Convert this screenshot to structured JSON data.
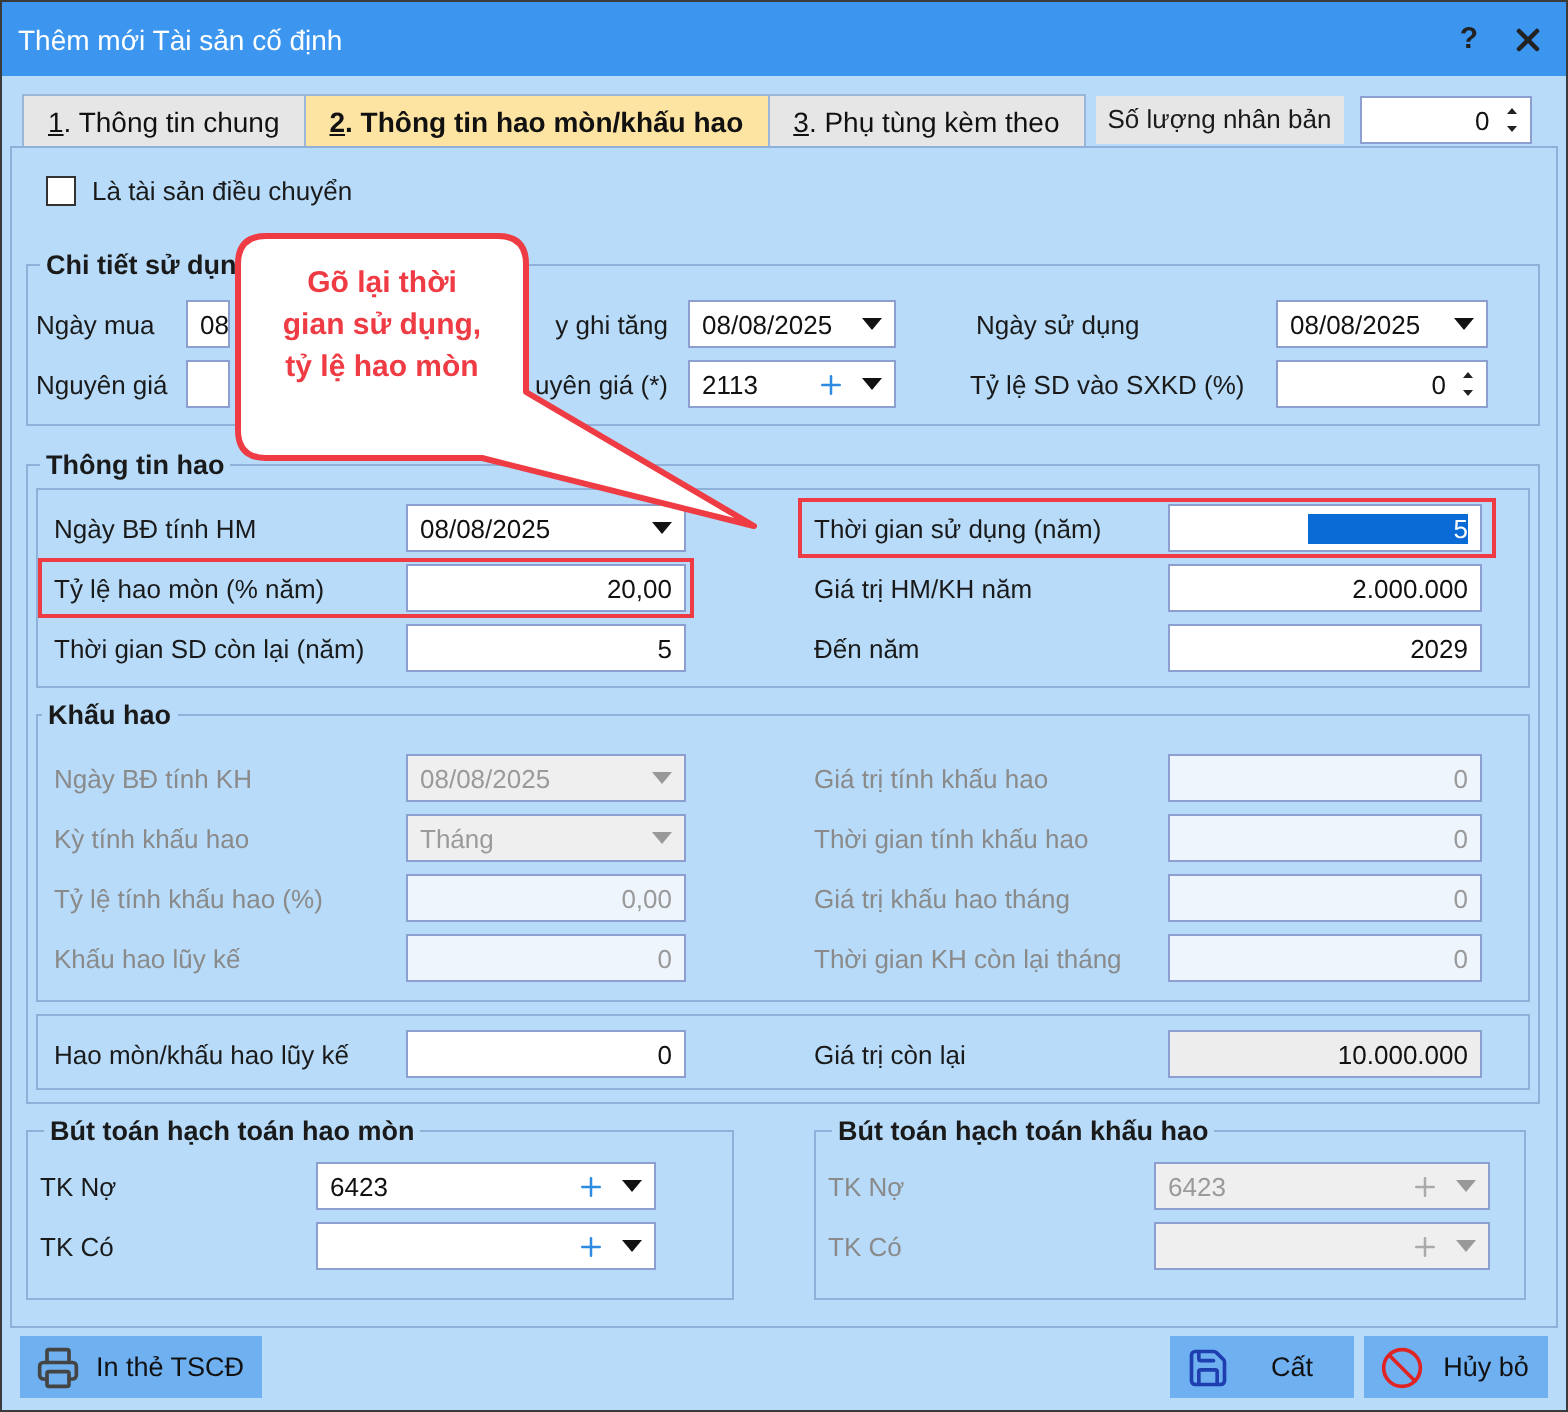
{
  "window": {
    "title": "Thêm mới Tài sản cố định",
    "help": "?"
  },
  "tabs": [
    {
      "label": "1. Thông tin chung",
      "selected": false
    },
    {
      "label": "2. Thông tin hao mòn/khấu hao",
      "selected": true
    },
    {
      "label": "3. Phụ tùng kèm theo",
      "selected": false
    }
  ],
  "copies": {
    "label": "Số lượng nhân bản",
    "value": "0"
  },
  "transfer": {
    "label": "Là tài sản điều chuyển",
    "checked": false
  },
  "usage": {
    "title": "Chi tiết sử dụn",
    "rows": [
      [
        {
          "label": "Ngày mua",
          "kind": "text",
          "value": "08"
        },
        {
          "label": "y ghi tăng",
          "kind": "date",
          "value": "08/08/2025"
        },
        {
          "label": "Ngày sử dụng",
          "kind": "date",
          "value": "08/08/2025"
        }
      ],
      [
        {
          "label": "Nguyên giá",
          "kind": "text"
        },
        {
          "label": "uyên giá (*)",
          "kind": "lookup",
          "value": "2113"
        },
        {
          "label": "Tỷ lệ SD vào SXKD (%)",
          "kind": "spin",
          "value": "0"
        }
      ]
    ]
  },
  "depreciation": {
    "title": "Thông tin hao",
    "wear": [
      [
        {
          "label": "Ngày BĐ tính HM",
          "kind": "date",
          "value": "08/08/2025",
          "highlighted": false,
          "value_selected": false
        },
        {
          "label": "Thời gian sử dụng (năm)",
          "kind": "number",
          "value": "5",
          "highlighted": true,
          "value_selected": true
        }
      ],
      [
        {
          "label": "Tỷ lệ hao mòn (% năm)",
          "kind": "number",
          "value": "20,00",
          "highlighted": true,
          "value_selected": false
        },
        {
          "label": "Giá trị HM/KH năm",
          "kind": "number",
          "value": "2.000.000",
          "highlighted": false,
          "value_selected": false
        }
      ],
      [
        {
          "label": "Thời gian SD còn lại (năm)",
          "kind": "number",
          "value": "5",
          "highlighted": false,
          "value_selected": false
        },
        {
          "label": "Đến năm",
          "kind": "number",
          "value": "2029",
          "highlighted": false,
          "value_selected": false
        }
      ]
    ],
    "amortization": {
      "title": "Khấu hao",
      "rows": [
        [
          {
            "label": "Ngày BĐ tính KH",
            "kind": "date",
            "value": "08/08/2025",
            "disabled": true
          },
          {
            "label": "Giá trị tính khấu hao",
            "kind": "number",
            "value": "0",
            "disabled": true
          }
        ],
        [
          {
            "label": "Kỳ tính khấu hao",
            "kind": "combo",
            "value": "Tháng",
            "disabled": true
          },
          {
            "label": "Thời gian tính khấu hao",
            "kind": "number",
            "value": "0",
            "disabled": true
          }
        ],
        [
          {
            "label": "Tỷ lệ tính khấu hao (%)",
            "kind": "number",
            "value": "0,00",
            "disabled": true
          },
          {
            "label": "Giá trị khấu hao tháng",
            "kind": "number",
            "value": "0",
            "disabled": true
          }
        ],
        [
          {
            "label": "Khấu hao lũy kế",
            "kind": "number",
            "value": "0",
            "disabled": true
          },
          {
            "label": "Thời gian KH còn lại tháng",
            "kind": "number",
            "value": "0",
            "disabled": true
          }
        ]
      ]
    },
    "totals": [
      {
        "label": "Hao mòn/khấu hao lũy kế",
        "kind": "number",
        "value": "0",
        "readonly": false
      },
      {
        "label": "Giá trị còn lại",
        "kind": "number",
        "value": "10.000.000",
        "readonly": true
      }
    ]
  },
  "postings": [
    {
      "title": "Bút toán hạch toán hao mòn",
      "disabled": false,
      "rows": [
        {
          "label": "TK Nợ",
          "value": "6423"
        },
        {
          "label": "TK Có"
        }
      ]
    },
    {
      "title": "Bút toán hạch toán khấu hao",
      "disabled": true,
      "rows": [
        {
          "label": "TK Nợ",
          "value": "6423"
        },
        {
          "label": "TK Có"
        }
      ]
    }
  ],
  "buttons": [
    {
      "label": "In thẻ TSCĐ"
    },
    {
      "label": "Cất"
    },
    {
      "label": "Hủy bỏ"
    }
  ],
  "callout": {
    "text": "Gõ lại thời gian sử dụng, tỷ lệ hao mòn"
  }
}
